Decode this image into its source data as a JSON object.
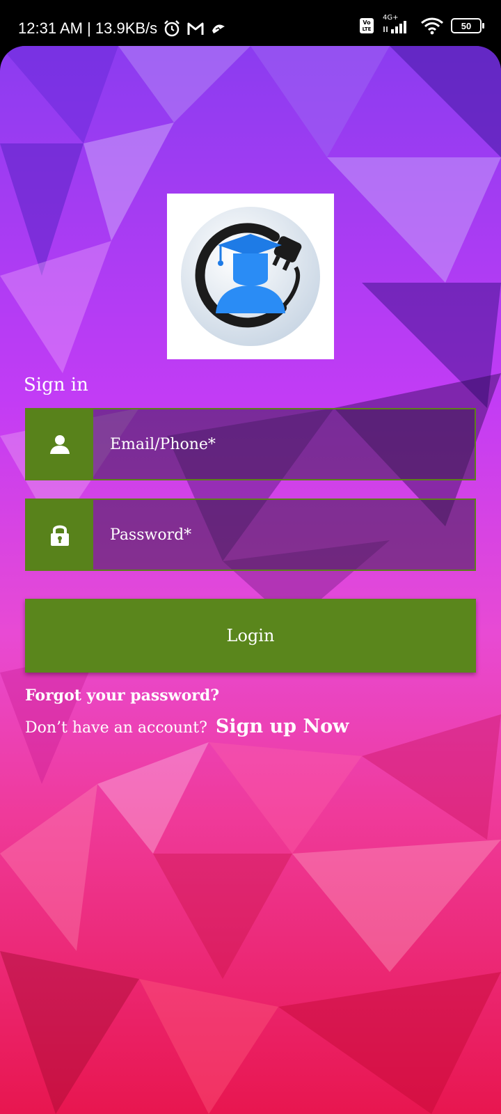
{
  "status_bar": {
    "time_speed": "12:31 AM | 13.9KB/s",
    "network_type": "4G+",
    "volte": "Vo LTE",
    "battery": "50",
    "icons": [
      "alarm-icon",
      "gmail-icon",
      "app-notification-icon",
      "volte-icon",
      "signal-icon",
      "wifi-icon",
      "battery-icon"
    ]
  },
  "form": {
    "heading": "Sign in",
    "email_placeholder": "Email/Phone*",
    "password_placeholder": "Password*",
    "login_label": "Login",
    "forgot_label": "Forgot your password?",
    "no_account_text": "Don’t have an account?",
    "signup_label": "Sign up Now"
  },
  "colors": {
    "accent_green": "#5a861c",
    "field_fill": "#3c1e50"
  }
}
